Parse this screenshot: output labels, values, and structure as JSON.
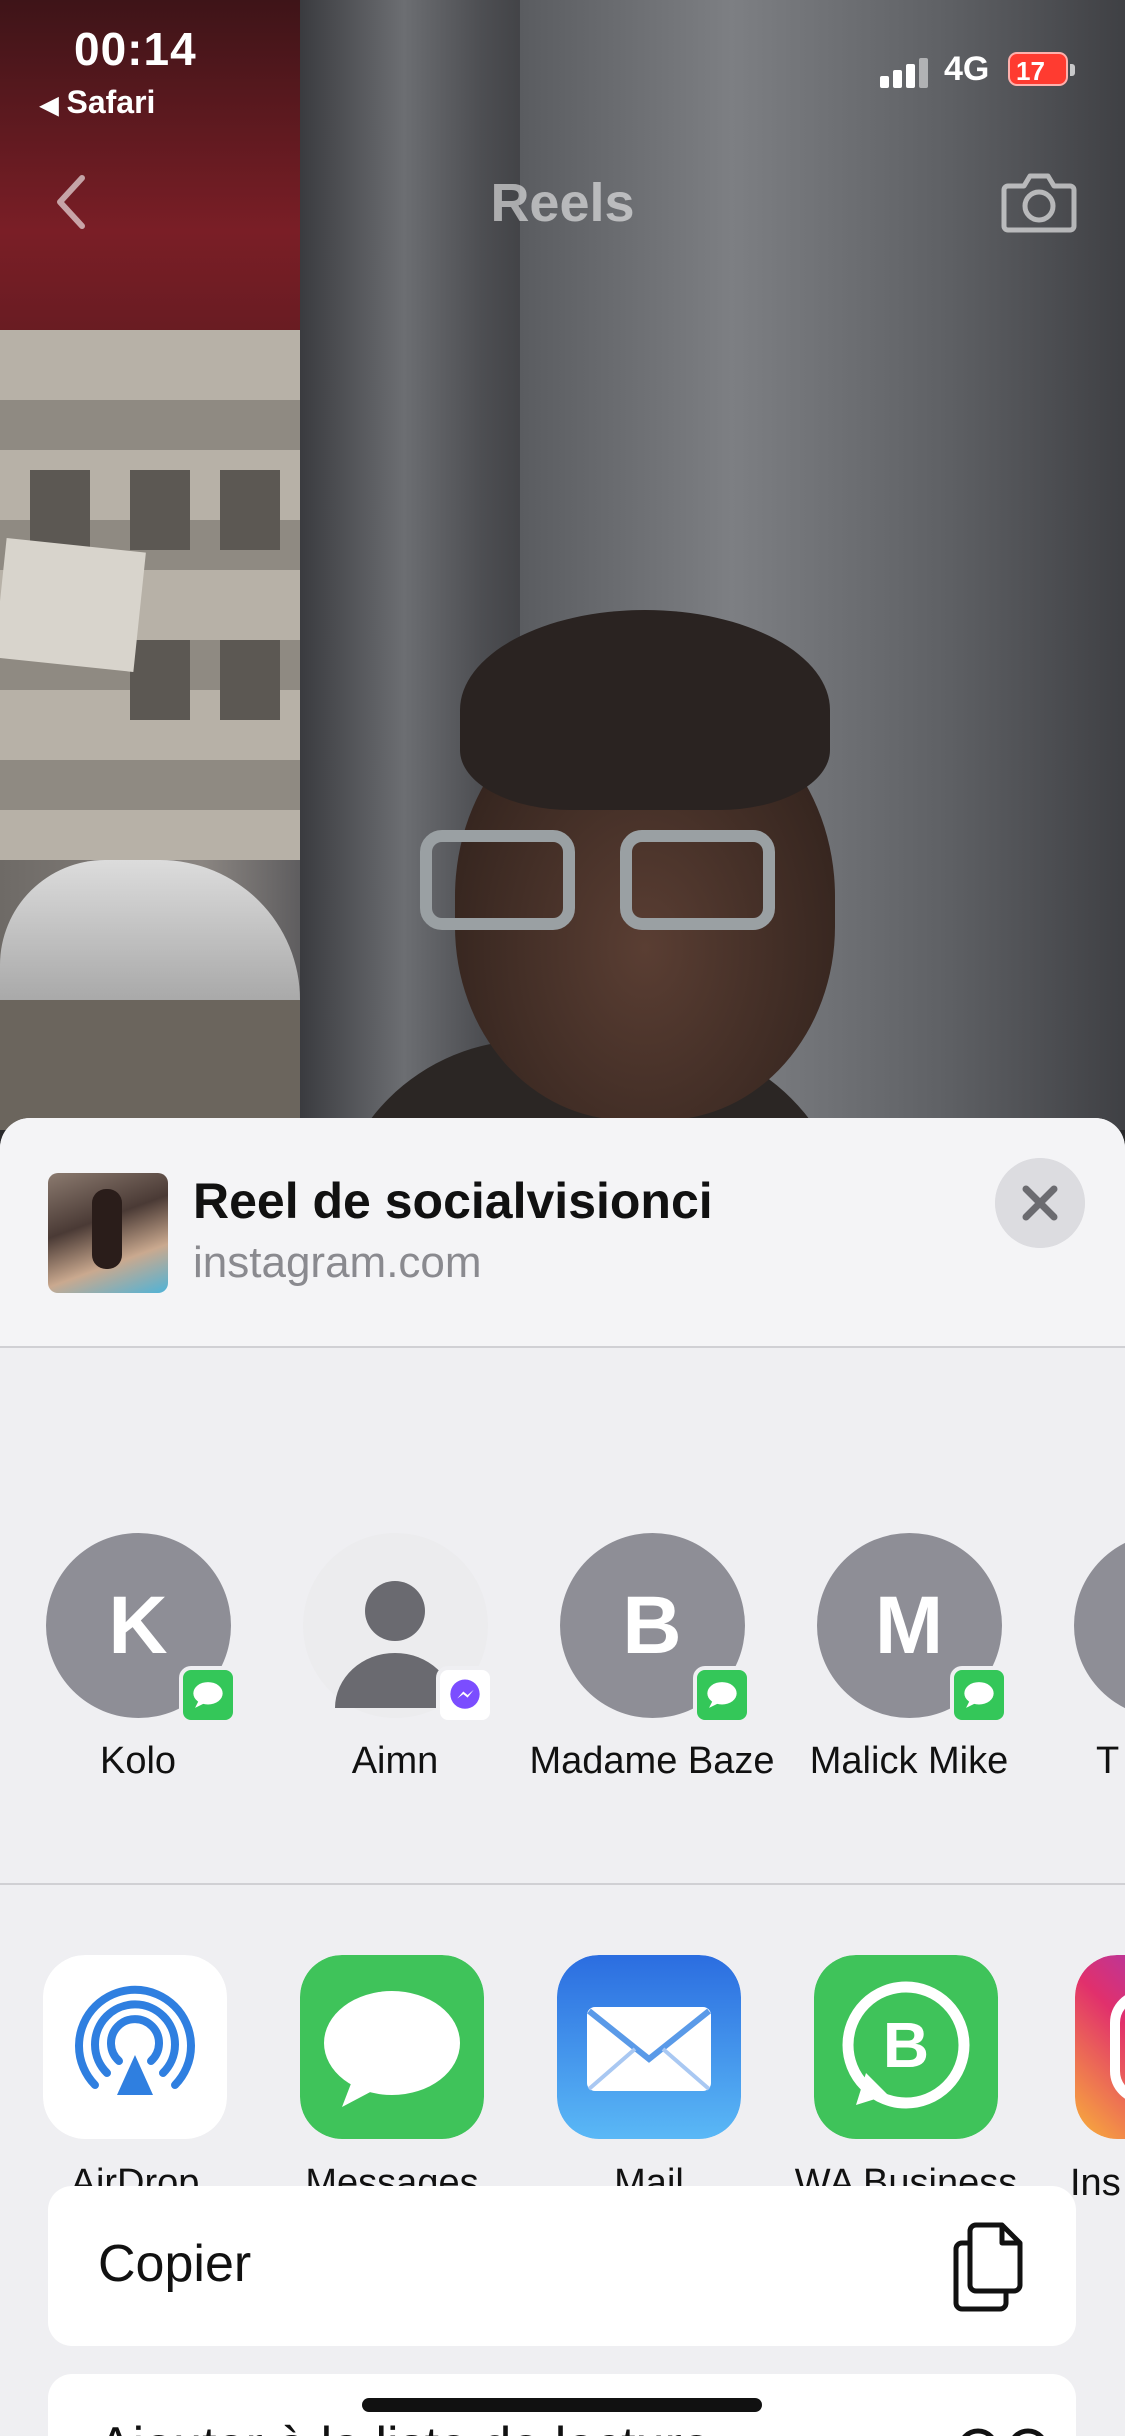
{
  "status_bar": {
    "time": "00:14",
    "back_app": "Safari",
    "network": "4G",
    "battery": "17"
  },
  "nav": {
    "title": "Reels",
    "back_icon": "chevron-left-icon",
    "camera_icon": "camera-icon"
  },
  "share": {
    "title": "Reel de socialvisionci",
    "subtitle": "instagram.com",
    "people": [
      {
        "initial": "K",
        "name": "Kolo",
        "badge": "messages-icon"
      },
      {
        "initial": "",
        "name": "Aimn",
        "badge": "messenger-icon"
      },
      {
        "initial": "B",
        "name": "Madame Baze",
        "badge": "messages-icon"
      },
      {
        "initial": "M",
        "name": "Malick Mike",
        "badge": "messages-icon"
      },
      {
        "initial": "",
        "name": "T O",
        "badge": ""
      }
    ],
    "apps": [
      {
        "label": "AirDrop",
        "icon": "airdrop-icon"
      },
      {
        "label": "Messages",
        "icon": "messages-app-icon"
      },
      {
        "label": "Mail",
        "icon": "mail-icon"
      },
      {
        "label": "WA Business",
        "icon": "whatsapp-business-icon"
      },
      {
        "label": "Ins",
        "icon": "instagram-icon"
      }
    ],
    "actions": [
      {
        "label": "Copier",
        "icon": "copy-icon"
      },
      {
        "label": "Ajouter à la liste de lecture",
        "icon": "reading-list-icon"
      }
    ]
  },
  "colors": {
    "messages_green": "#34c759",
    "mail_blue": "#3b82f6",
    "airdrop_blue": "#2f7fe0"
  }
}
